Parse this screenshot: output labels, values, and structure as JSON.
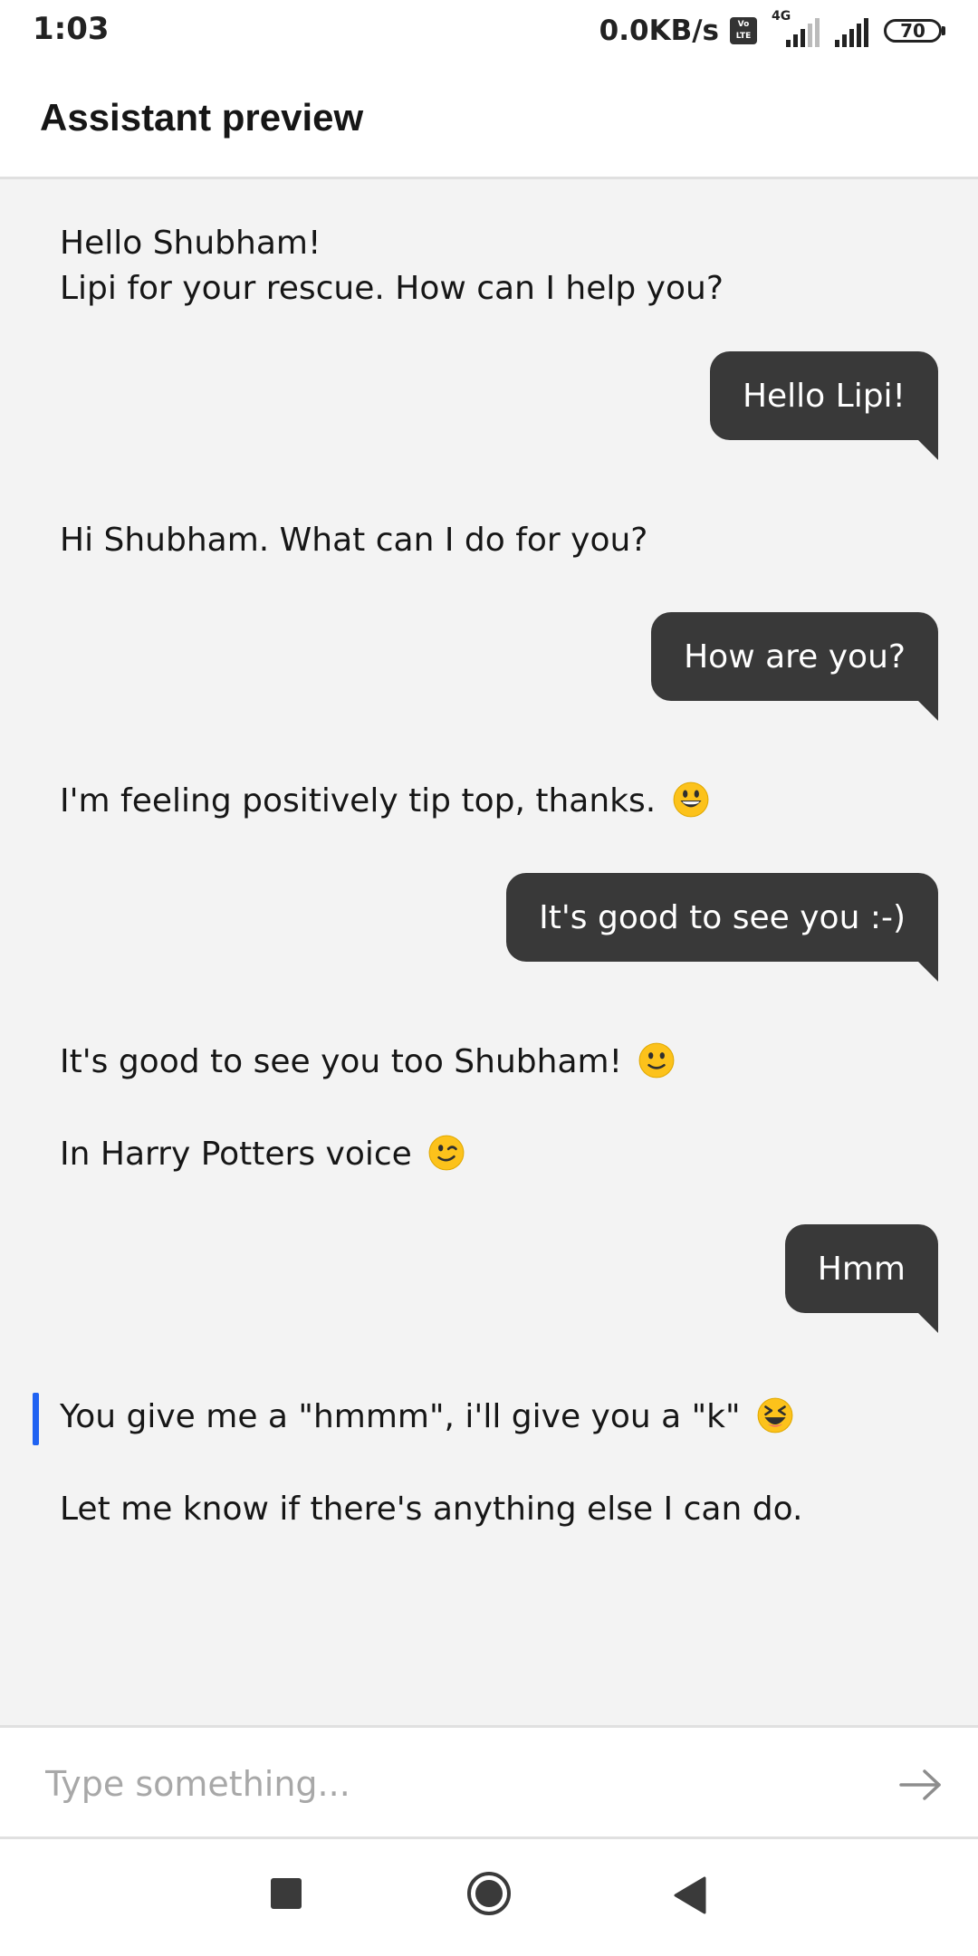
{
  "status_bar": {
    "time": "1:03",
    "network_speed": "0.0KB/s",
    "volte_top": "Vo",
    "volte_bottom": "LTE",
    "network_type": "4G",
    "battery": "70"
  },
  "header": {
    "title": "Assistant preview"
  },
  "chat": {
    "messages": [
      {
        "sender": "bot",
        "lines": [
          "Hello Shubham!",
          "Lipi for your rescue. How can I help you?"
        ]
      },
      {
        "sender": "user",
        "text": "Hello Lipi!"
      },
      {
        "sender": "bot",
        "text": "Hi Shubham. What can I do for you?"
      },
      {
        "sender": "user",
        "text": "How are you?"
      },
      {
        "sender": "bot",
        "text": "I'm feeling positively tip top, thanks.",
        "emoji": "grinning-face"
      },
      {
        "sender": "user",
        "text": "It's good to see you :-)"
      },
      {
        "sender": "bot",
        "text": "It's good to see you too Shubham!",
        "emoji": "slightly-smiling-face"
      },
      {
        "sender": "bot",
        "text": "In Harry Potters voice",
        "emoji": "winking-face"
      },
      {
        "sender": "user",
        "text": "Hmm"
      },
      {
        "sender": "bot",
        "text": "You give me a \"hmmm\", i'll give you a \"k\"",
        "emoji": "squinting-laughing-face"
      },
      {
        "sender": "bot",
        "text": "Let me know if there's anything else I can do."
      }
    ]
  },
  "input": {
    "placeholder": "Type something...",
    "send_icon": "arrow-right-icon"
  },
  "nav": {
    "recents_icon": "square-icon",
    "home_icon": "circle-icon",
    "back_icon": "triangle-back-icon"
  },
  "colors": {
    "chat_background": "#f3f3f3",
    "user_bubble": "#393939",
    "focus_bar": "#1f62f2"
  }
}
